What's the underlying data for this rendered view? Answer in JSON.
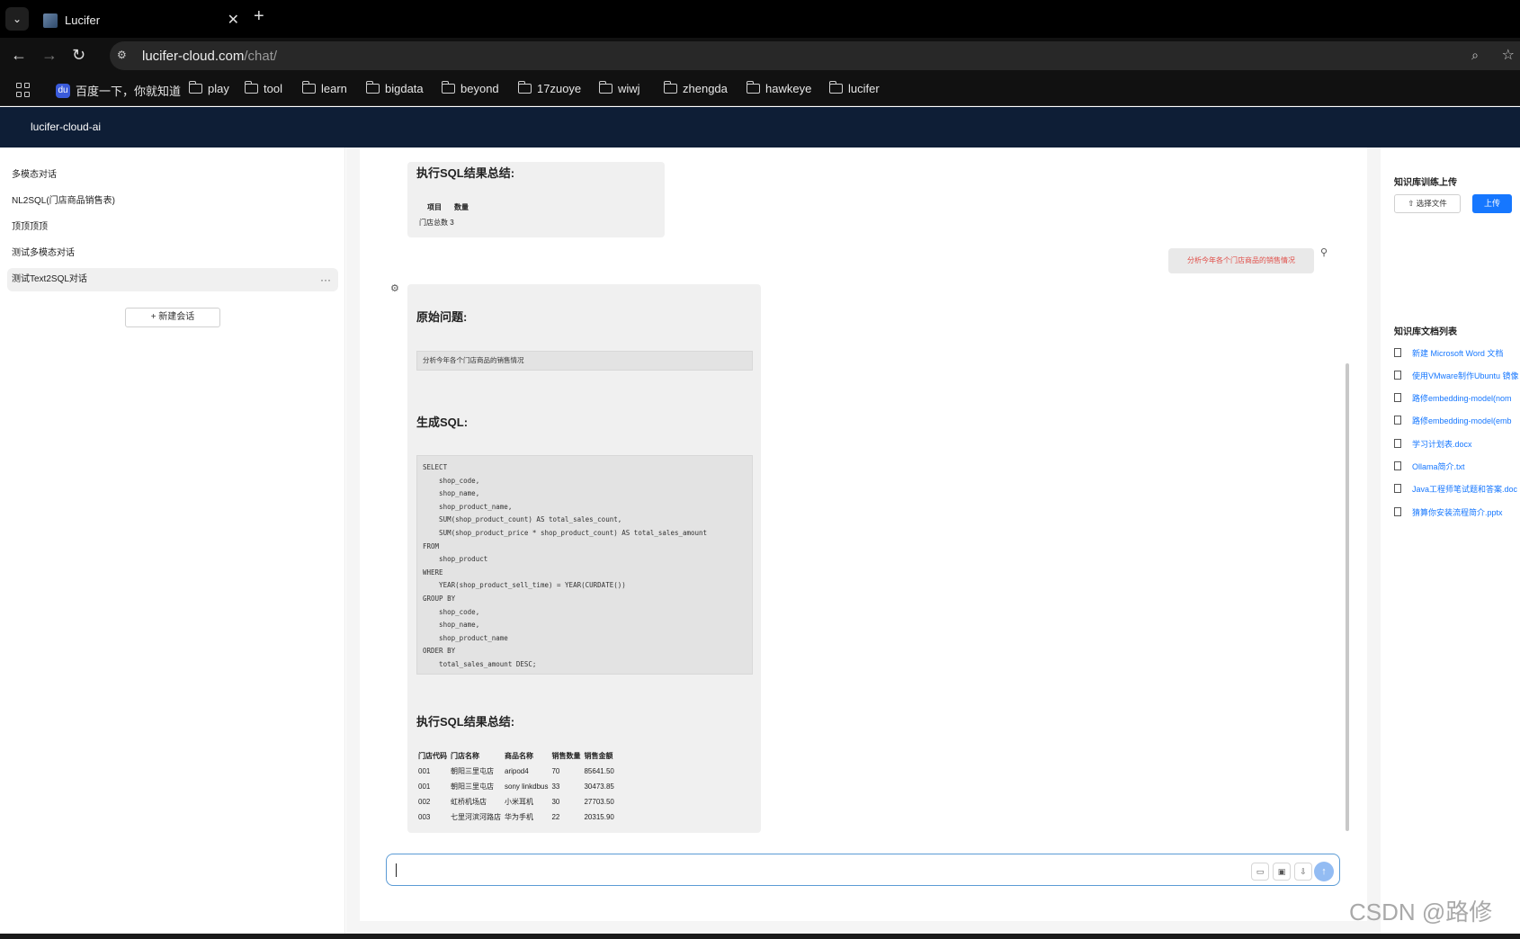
{
  "browser": {
    "tab_title": "Lucifer",
    "url_host": "lucifer-cloud.com",
    "url_path": "/chat/",
    "bookmarks": [
      "百度一下，你就知道",
      "play",
      "tool",
      "learn",
      "bigdata",
      "beyond",
      "17zuoye",
      "wiwj",
      "zhengda",
      "hawkeye",
      "lucifer"
    ]
  },
  "app": {
    "title": "lucifer-cloud-ai"
  },
  "sidebar": {
    "conversations": [
      "多模态对话",
      "NL2SQL(门店商品销售表)",
      "顶顶顶顶",
      "测试多模态对话",
      "测试Text2SQL对话"
    ],
    "active_index": 4,
    "new_chat_label": "+ 新建会话"
  },
  "chat": {
    "prev_message": {
      "summary_heading": "执行SQL结果总结:",
      "table_headers": [
        "项目",
        "数量"
      ],
      "row_text": "门店总数 3"
    },
    "user_message": "分析今年各个门店商品的销售情况",
    "bot_message": {
      "original_heading": "原始问题:",
      "original_question": "分析今年各个门店商品的销售情况",
      "sql_heading": "生成SQL:",
      "sql": "SELECT\n    shop_code,\n    shop_name,\n    shop_product_name,\n    SUM(shop_product_count) AS total_sales_count,\n    SUM(shop_product_price * shop_product_count) AS total_sales_amount\nFROM\n    shop_product\nWHERE\n    YEAR(shop_product_sell_time) = YEAR(CURDATE())\nGROUP BY\n    shop_code,\n    shop_name,\n    shop_product_name\nORDER BY\n    total_sales_amount DESC;",
      "summary_heading": "执行SQL结果总结:",
      "table": {
        "headers": [
          "门店代码",
          "门店名称",
          "商品名称",
          "销售数量",
          "销售金额"
        ],
        "rows": [
          [
            "001",
            "朝阳三里屯店",
            "aripod4",
            "70",
            "85641.50"
          ],
          [
            "001",
            "朝阳三里屯店",
            "sony linkdbus",
            "33",
            "30473.85"
          ],
          [
            "002",
            "虹桥机场店",
            "小米耳机",
            "30",
            "27703.50"
          ],
          [
            "003",
            "七里河滨河路店",
            "华为手机",
            "22",
            "20315.90"
          ]
        ]
      }
    },
    "input": {
      "value": "",
      "placeholder": ""
    }
  },
  "right_panel": {
    "upload_title": "知识库训练上传",
    "choose_file_label": "选择文件",
    "upload_label": "上传",
    "docs_title": "知识库文档列表",
    "docs": [
      "新建 Microsoft Word 文档",
      "使用VMware制作Ubuntu 镜像",
      "路修embedding-model(nom",
      "路修embedding-model(emb",
      "学习计划表.docx",
      "Ollama简介.txt",
      "Java工程师笔试题和答案.doc",
      "猜算你安装流程简介.pptx"
    ]
  },
  "watermark": "CSDN @路修",
  "colors": {
    "header_bg": "#0e1e36",
    "accent": "#1677ff",
    "user_text": "#e0504a"
  }
}
